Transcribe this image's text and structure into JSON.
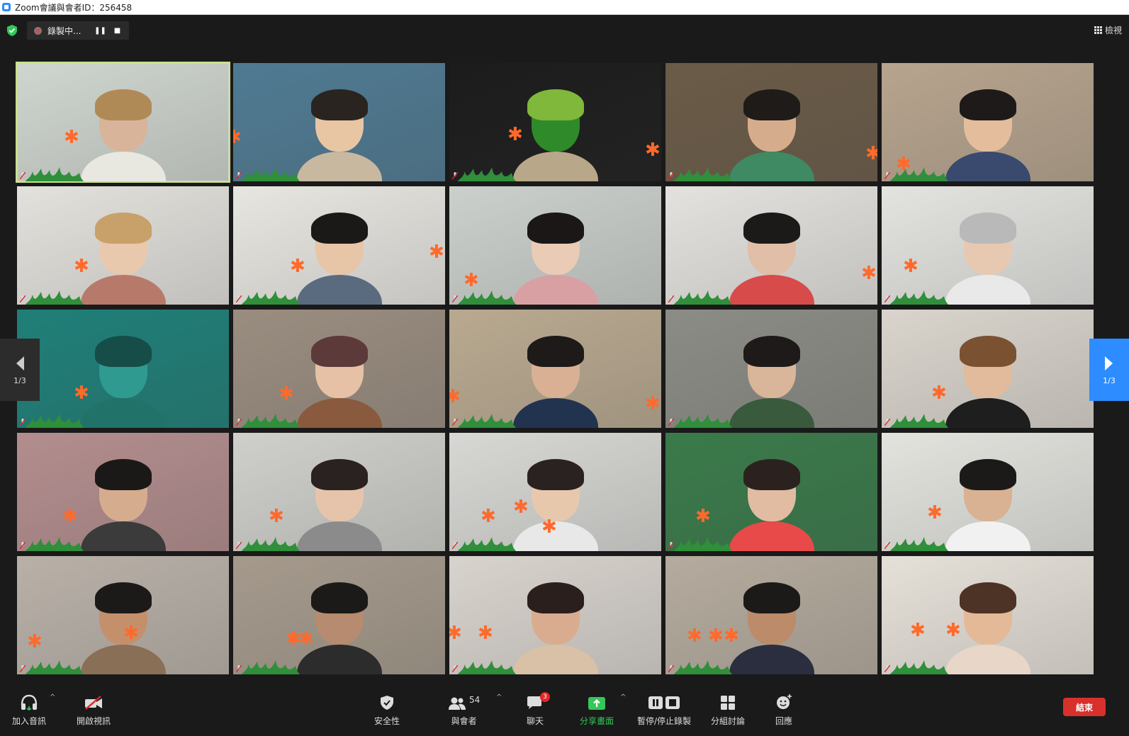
{
  "window": {
    "title": "Zoom會議與會者ID：256458"
  },
  "recording": {
    "status": "錄製中...",
    "pause_glyph": "❚❚",
    "stop_glyph": "■"
  },
  "view": {
    "label": "檢視"
  },
  "pagination": {
    "left": "1/3",
    "right": "1/3"
  },
  "toolbar": {
    "join_audio": "加入音訊",
    "start_video": "開啟視訊",
    "security": "安全性",
    "participants": "與會者",
    "participants_count": "54",
    "chat": "聊天",
    "chat_badge": "3",
    "share_screen": "分享畫面",
    "record": "暫停/停止錄製",
    "breakout": "分組討論",
    "reactions": "回應",
    "end": "結束",
    "caret": "^"
  },
  "colors": {
    "accent": "#2d8cff",
    "active_speaker": "#c8e08a",
    "end_button": "#d8302c",
    "share_green": "#34c759",
    "flower": "#ff6a2c",
    "grass": "#2f8f3a"
  },
  "tiles": [
    {
      "bg": "#cfd5cf",
      "skin": "#d8b49a",
      "hair": "#b08a56",
      "shirt": "#e8e8e0",
      "active": true
    },
    {
      "bg": "#4f7a92",
      "skin": "#e8c6a4",
      "hair": "#2a2420",
      "shirt": "#c9b8a0"
    },
    {
      "bg": "#1c1c1c",
      "skin": "#2f8a2a",
      "hair": "#7fb83a",
      "shirt": "#b9a78a"
    },
    {
      "bg": "#6b5b48",
      "skin": "#d6ad8c",
      "hair": "#1f1b18",
      "shirt": "#3f8a62"
    },
    {
      "bg": "#b7a48e",
      "skin": "#e3bd9c",
      "hair": "#1d1a19",
      "shirt": "#3a4a6e"
    },
    {
      "bg": "#e3e1dc",
      "skin": "#e9c9ad",
      "hair": "#c8a06a",
      "shirt": "#b77a6a"
    },
    {
      "bg": "#e7e6e1",
      "skin": "#e7c5a7",
      "hair": "#1b1918",
      "shirt": "#5a6b80"
    },
    {
      "bg": "#cbd0cc",
      "skin": "#e9cbb6",
      "hair": "#1a1716",
      "shirt": "#d9a0a4"
    },
    {
      "bg": "#e4e2de",
      "skin": "#e0bea7",
      "hair": "#1c1a19",
      "shirt": "#d84b4b"
    },
    {
      "bg": "#e3e3e0",
      "skin": "#e7c9b2",
      "hair": "#b9b9b9",
      "shirt": "#e9e9e9"
    },
    {
      "bg": "#1f7f78",
      "skin": "#2f9a90",
      "hair": "#164d49",
      "shirt": "#217268"
    },
    {
      "bg": "#9a8d80",
      "skin": "#e7c1a6",
      "hair": "#5c3a3a",
      "shirt": "#8a5a3e"
    },
    {
      "bg": "#b9a990",
      "skin": "#d9b093",
      "hair": "#1d1a19",
      "shirt": "#22334f"
    },
    {
      "bg": "#8c8c86",
      "skin": "#d9b59a",
      "hair": "#1d1a19",
      "shirt": "#395a3c"
    },
    {
      "bg": "#d9d4cc",
      "skin": "#e2bb9c",
      "hair": "#7a5232",
      "shirt": "#1e1e1e"
    },
    {
      "bg": "#b38d8e",
      "skin": "#d6ac8f",
      "hair": "#1b1918",
      "shirt": "#3b3b3b"
    },
    {
      "bg": "#cfcfcb",
      "skin": "#e6c4ac",
      "hair": "#2a2220",
      "shirt": "#8b8b8b"
    },
    {
      "bg": "#d7d7d4",
      "skin": "#e8c8ac",
      "hair": "#2a2220",
      "shirt": "#e8e8e8"
    },
    {
      "bg": "#3a7a4a",
      "skin": "#e1bca3",
      "hair": "#2b2220",
      "shirt": "#e84a4a"
    },
    {
      "bg": "#e3e3de",
      "skin": "#d9b193",
      "hair": "#1c1a19",
      "shirt": "#f1f1f1"
    },
    {
      "bg": "#b9b1a8",
      "skin": "#c4906c",
      "hair": "#1c1a19",
      "shirt": "#8a6f57"
    },
    {
      "bg": "#a59a8c",
      "skin": "#b78b6f",
      "hair": "#1c1a19",
      "shirt": "#2c2c2c"
    },
    {
      "bg": "#d8d3cd",
      "skin": "#d9ac90",
      "hair": "#2a1f1c",
      "shirt": "#d8c1a6"
    },
    {
      "bg": "#b5ab9e",
      "skin": "#bb8b6a",
      "hair": "#1c1a19",
      "shirt": "#2a2e3e"
    },
    {
      "bg": "#e5e0d8",
      "skin": "#e3b998",
      "hair": "#4d3226",
      "shirt": "#e8d6c8"
    }
  ]
}
